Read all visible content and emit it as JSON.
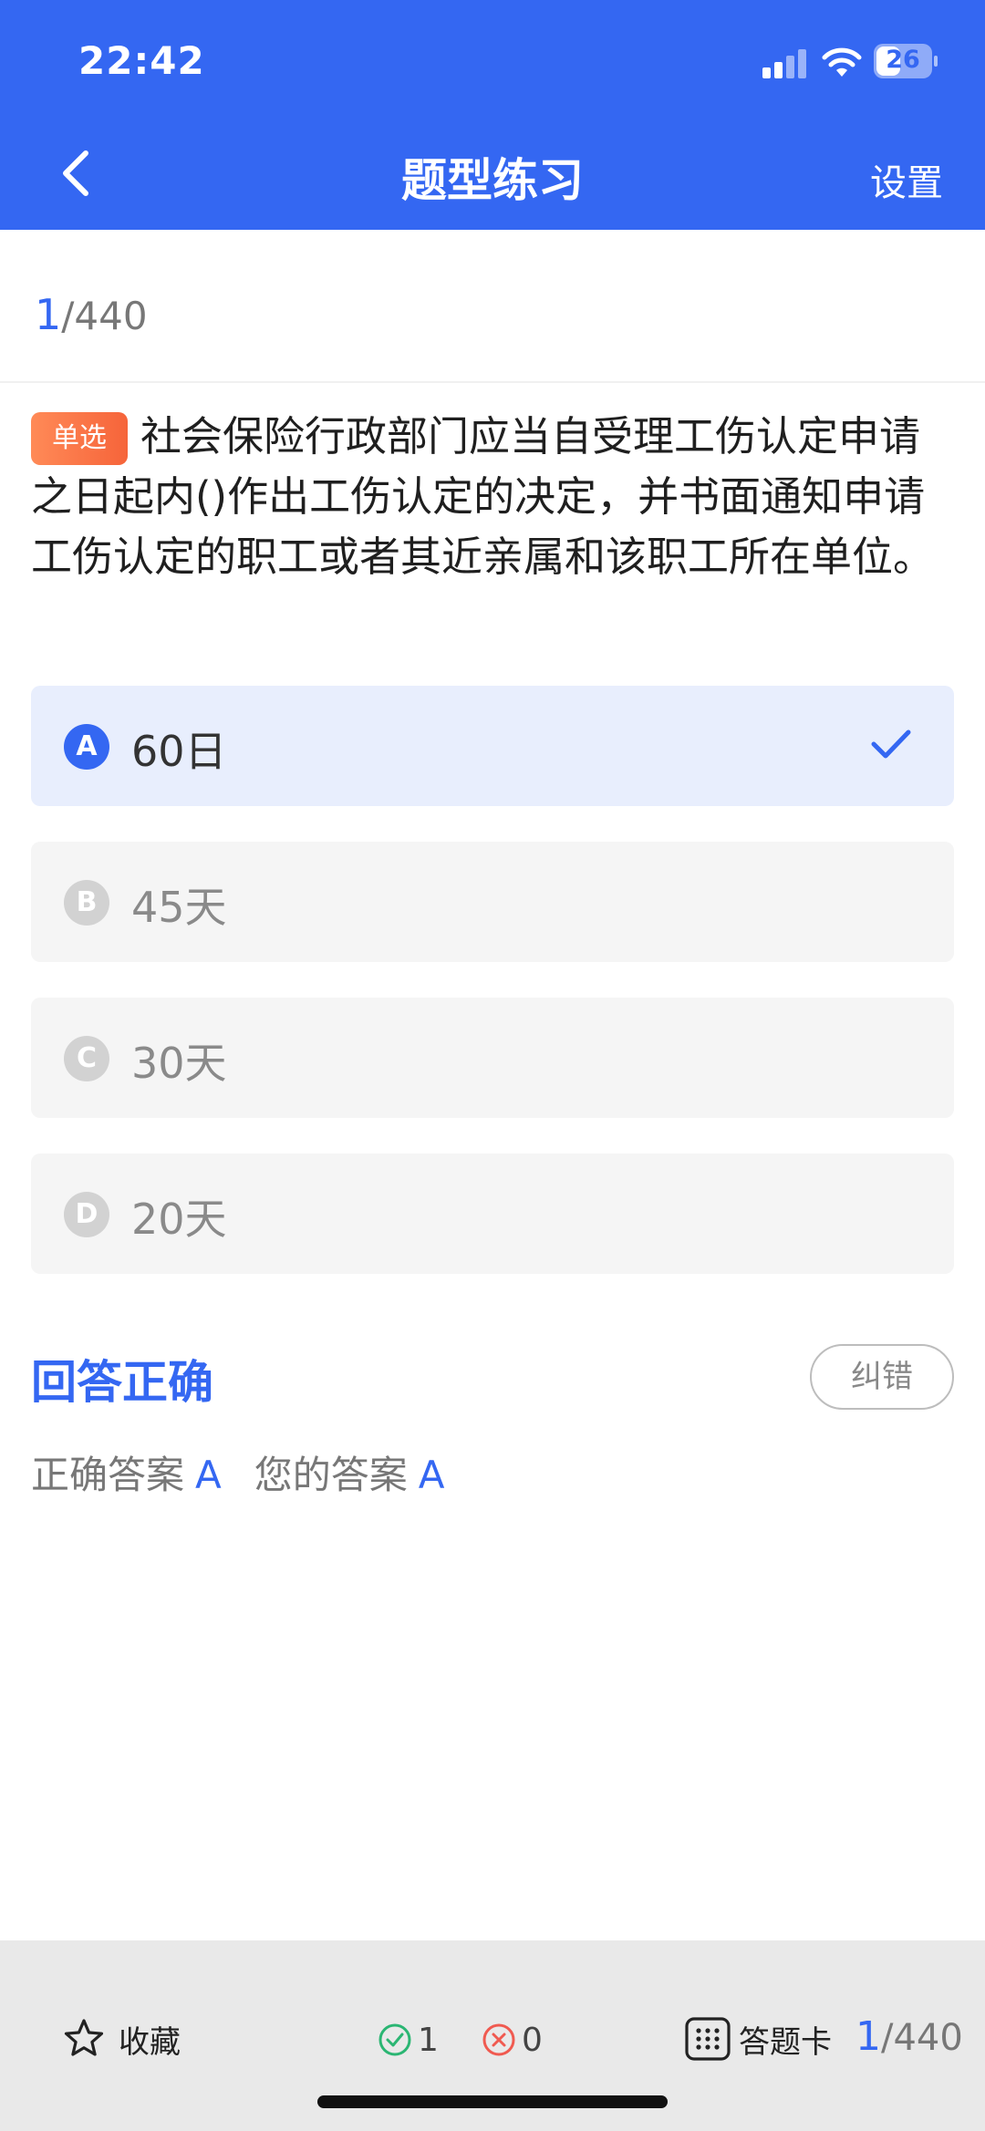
{
  "status_bar": {
    "time": "22:42",
    "battery": "26"
  },
  "nav": {
    "title": "题型练习",
    "settings_label": "设置"
  },
  "progress": {
    "current": "1",
    "total": "/440"
  },
  "question": {
    "type_tag": "单选",
    "text": "社会保险行政部门应当自受理工伤认定申请之日起内()作出工伤认定的决定，并书面通知申请工伤认定的职工或者其近亲属和该职工所在单位。"
  },
  "options": [
    {
      "letter": "A",
      "text": "60日",
      "selected": true
    },
    {
      "letter": "B",
      "text": "45天",
      "selected": false
    },
    {
      "letter": "C",
      "text": "30天",
      "selected": false
    },
    {
      "letter": "D",
      "text": "20天",
      "selected": false
    }
  ],
  "result": {
    "title": "回答正确",
    "report_label": "纠错",
    "correct_answer_label": "正确答案",
    "correct_answer": "A",
    "your_answer_label": "您的答案",
    "your_answer": "A"
  },
  "bottom_bar": {
    "favorite_label": "收藏",
    "correct_count": "1",
    "wrong_count": "0",
    "answer_card_label": "答题卡",
    "progress_current": "1",
    "progress_total": "/440"
  },
  "colors": {
    "primary": "#3467f2",
    "tag_orange": "#f6643a",
    "correct_green": "#2bb673",
    "wrong_red": "#f05a50"
  },
  "icons": [
    "back-arrow-icon",
    "signal-icon",
    "wifi-icon",
    "battery-icon",
    "check-icon",
    "star-icon",
    "check-circle-icon",
    "x-circle-icon",
    "grid-icon"
  ]
}
